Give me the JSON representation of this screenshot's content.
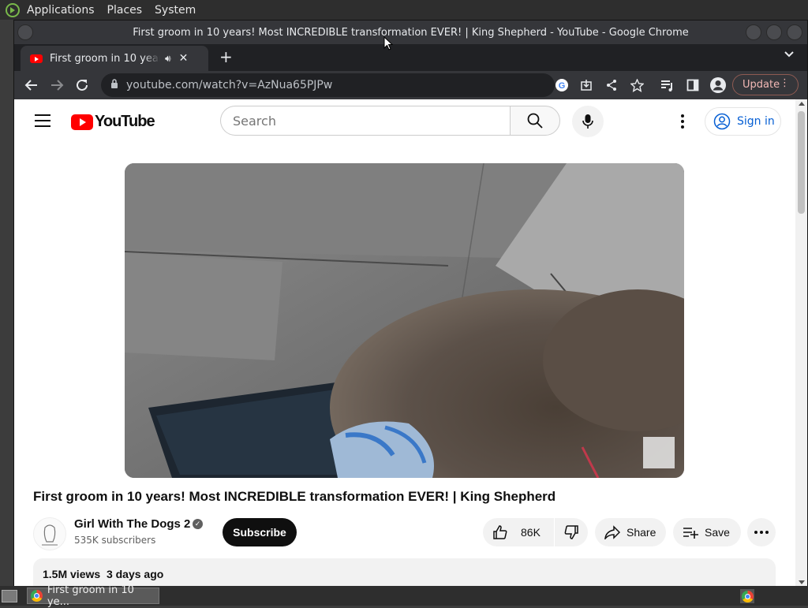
{
  "panel": {
    "menus": [
      "Applications",
      "Places",
      "System"
    ]
  },
  "window": {
    "title": "First groom in 10 years! Most INCREDIBLE transformation EVER! | King Shepherd - YouTube - Google Chrome"
  },
  "tab": {
    "title": "First groom in 10 years! Most INCREDIBLE transformation EVER! | King Shepherd - YouTube"
  },
  "toolbar": {
    "url": "youtube.com/watch?v=AzNua65PJPw",
    "update_label": "Update"
  },
  "youtube": {
    "logo_text": "YouTube",
    "search_placeholder": "Search",
    "signin_label": "Sign in"
  },
  "video": {
    "title": "First groom in 10 years! Most INCREDIBLE transformation EVER! | King Shepherd",
    "channel": "Girl With The Dogs 2",
    "subscribers": "535K subscribers",
    "subscribe_label": "Subscribe",
    "likes": "86K",
    "share_label": "Share",
    "save_label": "Save",
    "views": "1.5M views",
    "age": "3 days ago"
  },
  "taskbar": {
    "item_label": "First groom in 10 ye..."
  },
  "colors": {
    "youtube_red": "#ff0000",
    "link_blue": "#065fd4",
    "chrome_dark": "#35363a"
  }
}
